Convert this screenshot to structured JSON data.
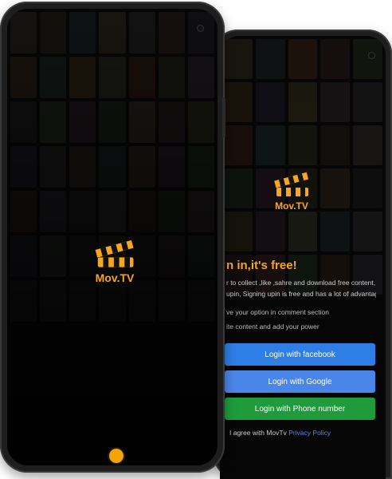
{
  "splash": {
    "app_name": "Mov.TV"
  },
  "login": {
    "app_name": "Mov.TV",
    "title": "n in,it's free!",
    "description_line1": "r to collect ,like ,sahre and download free content, you have to be",
    "description_line2": "upin, Signing upin  is free and has a lot of advantages:",
    "bullet1": "ve your option in comment section",
    "bullet2": "ite content and add your power",
    "facebook_button": "Login with facebook",
    "google_button": "Login with Google",
    "phone_button": "Login with Phone number",
    "agree_text": "I agree with  MovTv ",
    "privacy_link": "Privacy Policy"
  },
  "colors": {
    "accent": "#f5a623",
    "facebook": "#2f7ee6",
    "google": "#4a86e8",
    "phone": "#1f9b3c"
  }
}
